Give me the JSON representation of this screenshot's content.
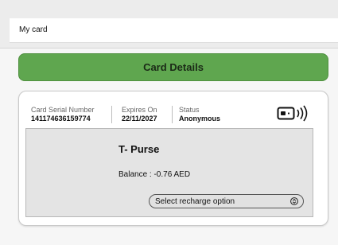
{
  "header": {
    "card_name": "My card"
  },
  "details_button": {
    "label": "Card Details"
  },
  "card": {
    "serial_label": "Card Serial Number",
    "serial_value": "141174636159774",
    "expires_label": "Expires On",
    "expires_value": "22/11/2027",
    "status_label": "Status",
    "status_value": "Anonymous",
    "nfc_icon": "contactless-card-icon"
  },
  "purse": {
    "title": "T- Purse",
    "balance": "Balance : -0.76 AED",
    "recharge_select": {
      "selected": "Select recharge option"
    }
  },
  "colors": {
    "accent_green": "#5fa64f",
    "page_bg": "#ececec",
    "purse_bg": "#e4e4e4"
  }
}
